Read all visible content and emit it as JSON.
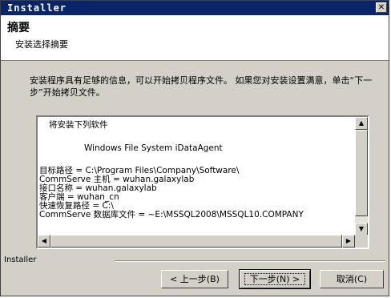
{
  "window": {
    "title": "Installer",
    "close_glyph": "✕"
  },
  "header": {
    "title": "摘要",
    "subtitle": "安装选择摘要"
  },
  "description": "安装程序具有足够的信息，可以开始拷贝程序文件。 如果您对安装设置满意，单击“下一步”开始拷贝文件。",
  "summary": {
    "heading": "将安装下列软件",
    "product": "Windows File System iDataAgent",
    "lines": [
      "目标路径 =  C:\\Program Files\\Company\\Software\\",
      "CommServe 主机 =  wuhan.galaxylab",
      "接口名称 =  wuhan.galaxylab",
      "客户端 =  wuhan_cn",
      "快速恢复路径 =  C:\\",
      "CommServe 数据库文件 = ~E:\\MSSQL2008\\MSSQL10.COMPANY"
    ]
  },
  "footer": {
    "label": "Installer"
  },
  "buttons": {
    "back": "< 上一步(B)",
    "next": "下一步(N) >",
    "cancel": "取消(C)"
  },
  "colors": {
    "titlebar": "#0a246a",
    "dialog_face": "#d4d0c8"
  }
}
